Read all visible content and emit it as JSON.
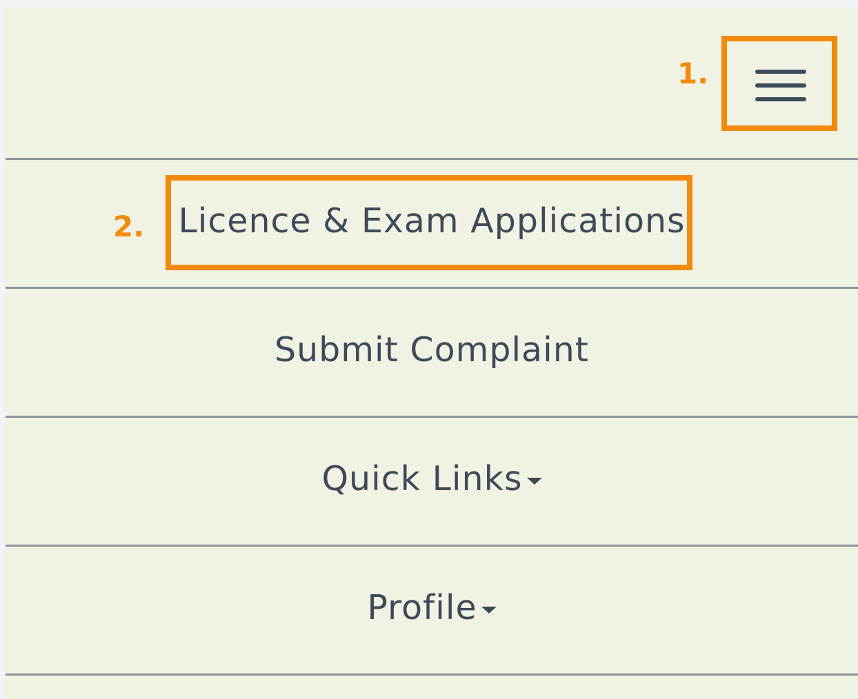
{
  "header": {
    "menu_icon": "hamburger-icon"
  },
  "menu": {
    "items": [
      {
        "label": "Licence & Exam Applications"
      },
      {
        "label": "Submit Complaint"
      },
      {
        "label": "Quick Links",
        "icon": "caret-down-icon"
      },
      {
        "label": "Profile",
        "icon": "caret-down-icon"
      }
    ]
  },
  "annotations": {
    "step1": "1.",
    "step2": "2.",
    "color": "#f28b0c"
  },
  "colors": {
    "background": "#f0f2e3",
    "text": "#3e4a5a",
    "divider": "#8a949c"
  }
}
